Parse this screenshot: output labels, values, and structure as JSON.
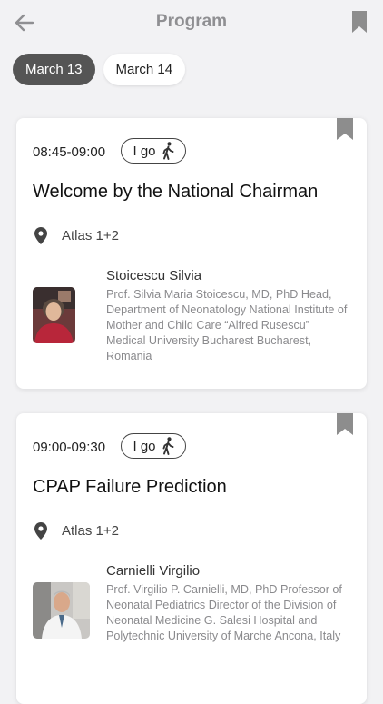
{
  "header": {
    "title": "Program"
  },
  "date_tabs": [
    {
      "label": "March 13",
      "selected": true
    },
    {
      "label": "March 14",
      "selected": false
    }
  ],
  "sessions": [
    {
      "time": "08:45-09:00",
      "igo_label": "I go",
      "title": "Welcome by the National Chairman",
      "location": "Atlas 1+2",
      "speaker": {
        "name": "Stoicescu Silvia",
        "bio": "Prof. Silvia Maria Stoicescu, MD, PhD Head, Department of Neonatology National Institute of Mother and Child Care “Alfred Rusescu” Medical University Bucharest Bucharest, Romania"
      }
    },
    {
      "time": "09:00-09:30",
      "igo_label": "I go",
      "title": "CPAP Failure Prediction",
      "location": "Atlas 1+2",
      "speaker": {
        "name": "Carnielli Virgilio",
        "bio": "Prof. Virgilio P. Carnielli, MD, PhD Professor of Neonatal Pediatrics Director of the Division of Neonatal Medicine G. Salesi Hospital and Polytechnic University of Marche Ancona, Italy"
      }
    }
  ],
  "icons": {
    "back": "arrow-left-icon",
    "bookmark": "bookmark-icon",
    "walk": "walking-person-icon",
    "location": "map-pin-icon"
  },
  "colors": {
    "selected_tab": "#555555",
    "background": "#f2f2f4",
    "bookmark": "#8d8d8d"
  }
}
